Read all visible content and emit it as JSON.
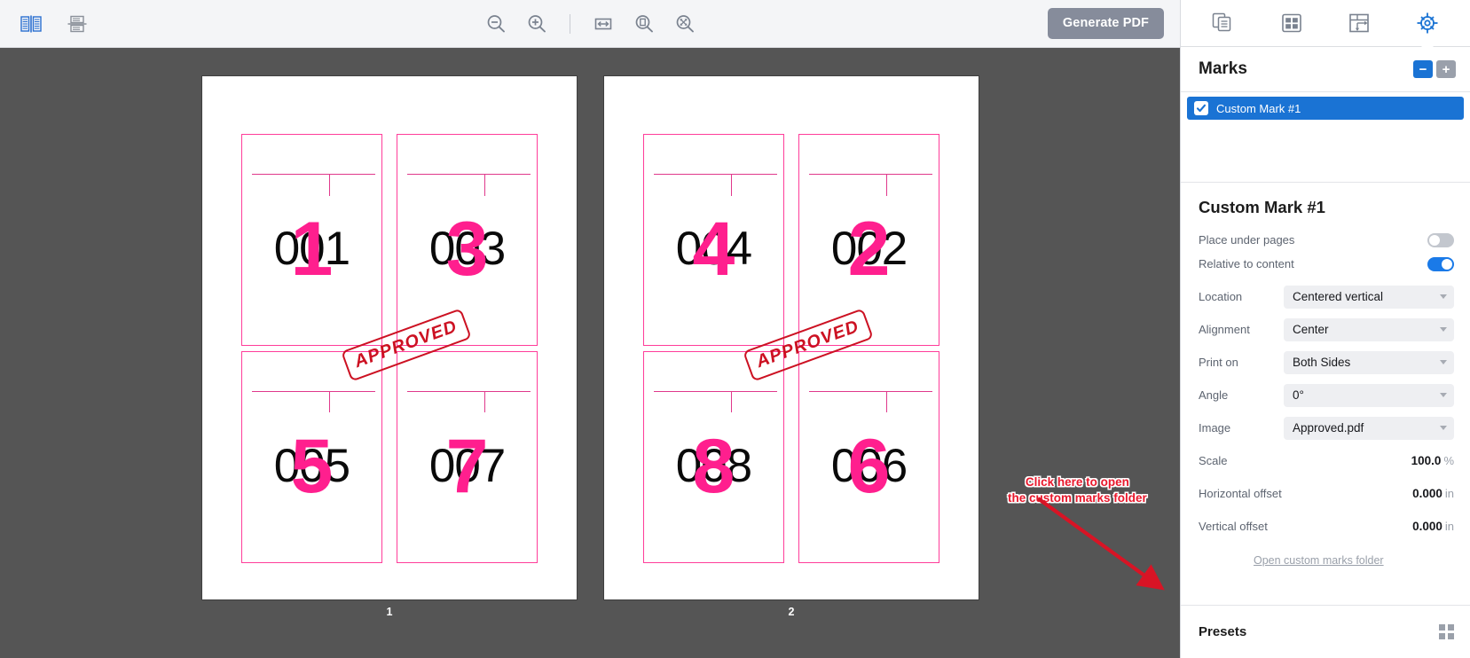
{
  "toolbar": {
    "left_icons": [
      {
        "name": "two-page-spread-icon",
        "label": "Spread view"
      },
      {
        "name": "single-page-icon",
        "label": "Single page view"
      }
    ],
    "center_icons": [
      {
        "name": "zoom-out-icon",
        "label": "Zoom out"
      },
      {
        "name": "zoom-in-icon",
        "label": "Zoom in"
      },
      {
        "name": "fit-width-icon",
        "label": "Fit width"
      },
      {
        "name": "fit-page-icon",
        "label": "Fit page"
      },
      {
        "name": "fit-window-icon",
        "label": "Fit window"
      }
    ],
    "generate_pdf_label": "Generate PDF"
  },
  "canvas": {
    "background_color": "#555555",
    "sheets": [
      {
        "page_label": "1",
        "stamp": "APPROVED",
        "cells": [
          {
            "black": "001",
            "pink": "1"
          },
          {
            "black": "003",
            "pink": "3"
          },
          {
            "black": "005",
            "pink": "5"
          },
          {
            "black": "007",
            "pink": "7"
          }
        ]
      },
      {
        "page_label": "2",
        "stamp": "APPROVED",
        "cells": [
          {
            "black": "004",
            "pink": "4"
          },
          {
            "black": "002",
            "pink": "2"
          },
          {
            "black": "008",
            "pink": "8"
          },
          {
            "black": "006",
            "pink": "6"
          }
        ]
      }
    ],
    "annotation": {
      "line1": "Click here to open",
      "line2": "the custom marks folder",
      "color": "#e8172b"
    }
  },
  "panel": {
    "tabs": [
      {
        "name": "tab-pages",
        "icon": "pages-stack-icon",
        "active": false
      },
      {
        "name": "tab-layout",
        "icon": "grid-layout-icon",
        "active": false
      },
      {
        "name": "tab-imposition",
        "icon": "imposition-flow-icon",
        "active": false
      },
      {
        "name": "tab-marks",
        "icon": "registration-target-icon",
        "active": true
      }
    ],
    "marks_header": "Marks",
    "remove_label": "−",
    "add_label": "+",
    "marks": [
      {
        "label": "Custom Mark #1",
        "checked": true,
        "selected": true
      }
    ],
    "properties_title": "Custom Mark #1",
    "properties": [
      {
        "type": "toggle",
        "label": "Place under pages",
        "value": false
      },
      {
        "type": "toggle",
        "label": "Relative to content",
        "value": true
      },
      {
        "type": "select",
        "label": "Location",
        "value": "Centered vertical"
      },
      {
        "type": "select",
        "label": "Alignment",
        "value": "Center"
      },
      {
        "type": "select",
        "label": "Print on",
        "value": "Both Sides"
      },
      {
        "type": "select",
        "label": "Angle",
        "value": "0°"
      },
      {
        "type": "select",
        "label": "Image",
        "value": "Approved.pdf"
      },
      {
        "type": "value",
        "label": "Scale",
        "value": "100.0",
        "unit": "%"
      },
      {
        "type": "value",
        "label": "Horizontal offset",
        "value": "0.000",
        "unit": "in"
      },
      {
        "type": "value",
        "label": "Vertical offset",
        "value": "0.000",
        "unit": "in"
      }
    ],
    "folder_link": "Open custom marks folder",
    "presets_header": "Presets",
    "accent_color": "#1a73d4"
  }
}
